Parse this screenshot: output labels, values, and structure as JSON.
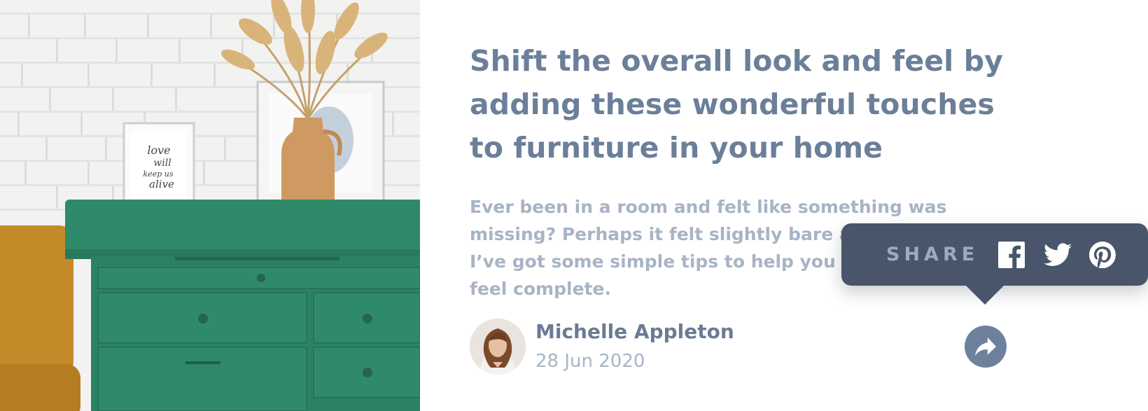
{
  "article": {
    "title": "Shift the overall look and feel by adding these wonderful touches to furniture in your home",
    "description": "Ever been in a room and felt like something was missing? Perhaps it felt slightly bare and uninviting. I’ve got some simple tips to help you make any room feel complete.",
    "image_alt": "Green wooden drawer with a vase of dried plants and picture frames",
    "frame_text": "love will keep us alive"
  },
  "author": {
    "name": "Michelle Appleton",
    "date": "28 Jun 2020"
  },
  "share": {
    "label": "SHARE",
    "networks": [
      "facebook",
      "twitter",
      "pinterest"
    ],
    "button_icon": "share-arrow-icon"
  },
  "colors": {
    "title": "#6b7f99",
    "description": "#a8b4c5",
    "tooltip_bg": "#48556a",
    "share_button": "#6e819c",
    "drawer_green": "#2f8a69"
  }
}
